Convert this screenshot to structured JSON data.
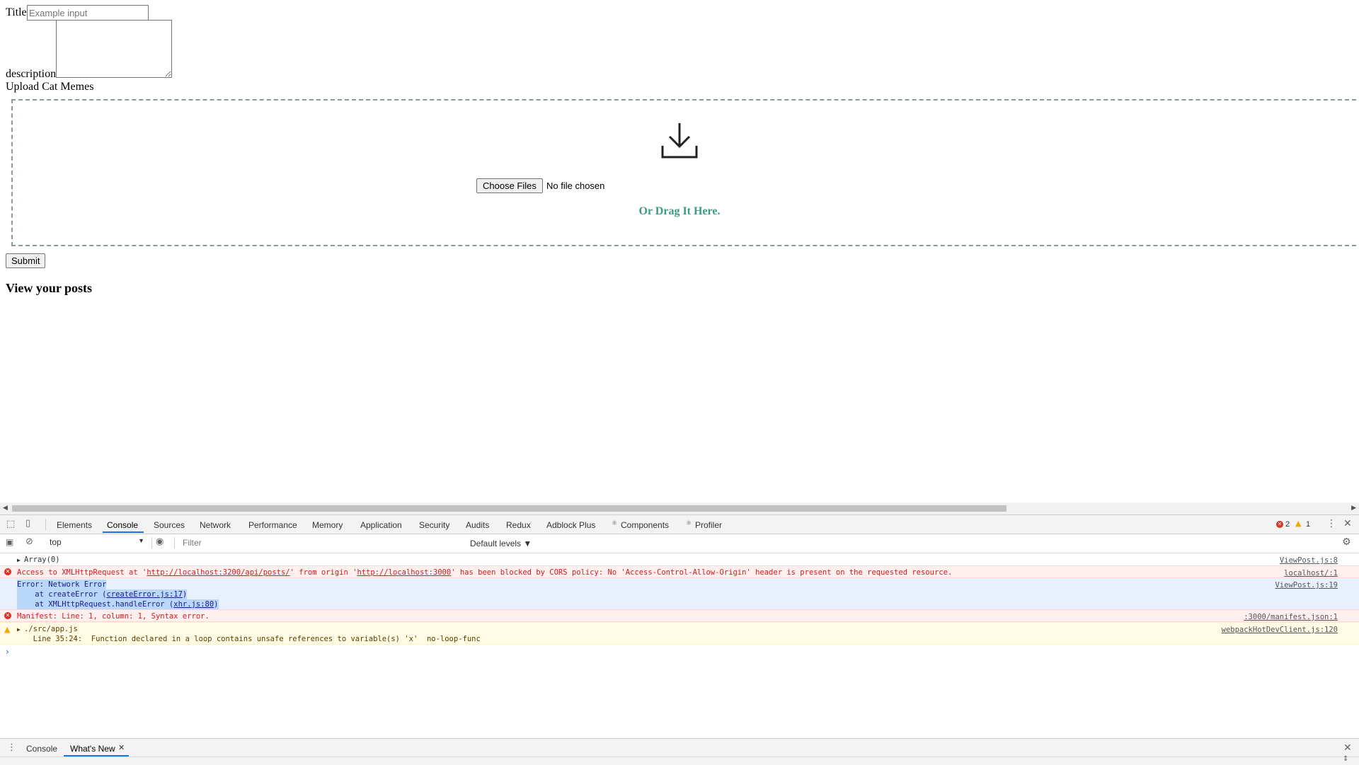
{
  "form": {
    "title_label": "Title",
    "title_placeholder": "Example input",
    "description_label": "description",
    "upload_label": "Upload Cat Memes",
    "choose_files": "Choose Files",
    "file_status": "No file chosen",
    "drag_text": "Or Drag It Here.",
    "submit": "Submit",
    "view_posts": "View your posts"
  },
  "devtools": {
    "tabs": [
      "Elements",
      "Console",
      "Sources",
      "Network",
      "Performance",
      "Memory",
      "Application",
      "Security",
      "Audits",
      "Redux",
      "Adblock Plus",
      "Components",
      "Profiler"
    ],
    "active_tab": "Console",
    "error_count": "2",
    "warning_count": "1",
    "context": "top",
    "filter_placeholder": "Filter",
    "levels": "Default levels ▼",
    "messages": {
      "m1": {
        "text": "Array(0)",
        "source": "ViewPost.js:8"
      },
      "m2": {
        "pre": "Access to XMLHttpRequest at '",
        "url1": "http://localhost:3200/api/posts/",
        "mid": "' from origin '",
        "url2": "http://localhost:3000",
        "post": "' has been blocked by CORS policy: No 'Access-Control-Allow-Origin' header is present on the requested resource.",
        "source": "localhost/:1"
      },
      "m3": {
        "line1": "Error: Network Error",
        "line2a": "    at createError (",
        "link2": "createError.js:17",
        "line2b": ")",
        "line3a": "    at XMLHttpRequest.handleError (",
        "link3": "xhr.js:80",
        "line3b": ")",
        "source": "ViewPost.js:19"
      },
      "m4": {
        "text": "Manifest: Line: 1, column: 1, Syntax error.",
        "source": ":3000/manifest.json:1"
      },
      "m5": {
        "line1": "./src/app.js",
        "line2": "  Line 35:24:  Function declared in a loop contains unsafe references to variable(s) 'x'  no-loop-func",
        "source": "webpackHotDevClient.js:120"
      }
    },
    "drawer_tabs": [
      "Console",
      "What's New"
    ]
  }
}
